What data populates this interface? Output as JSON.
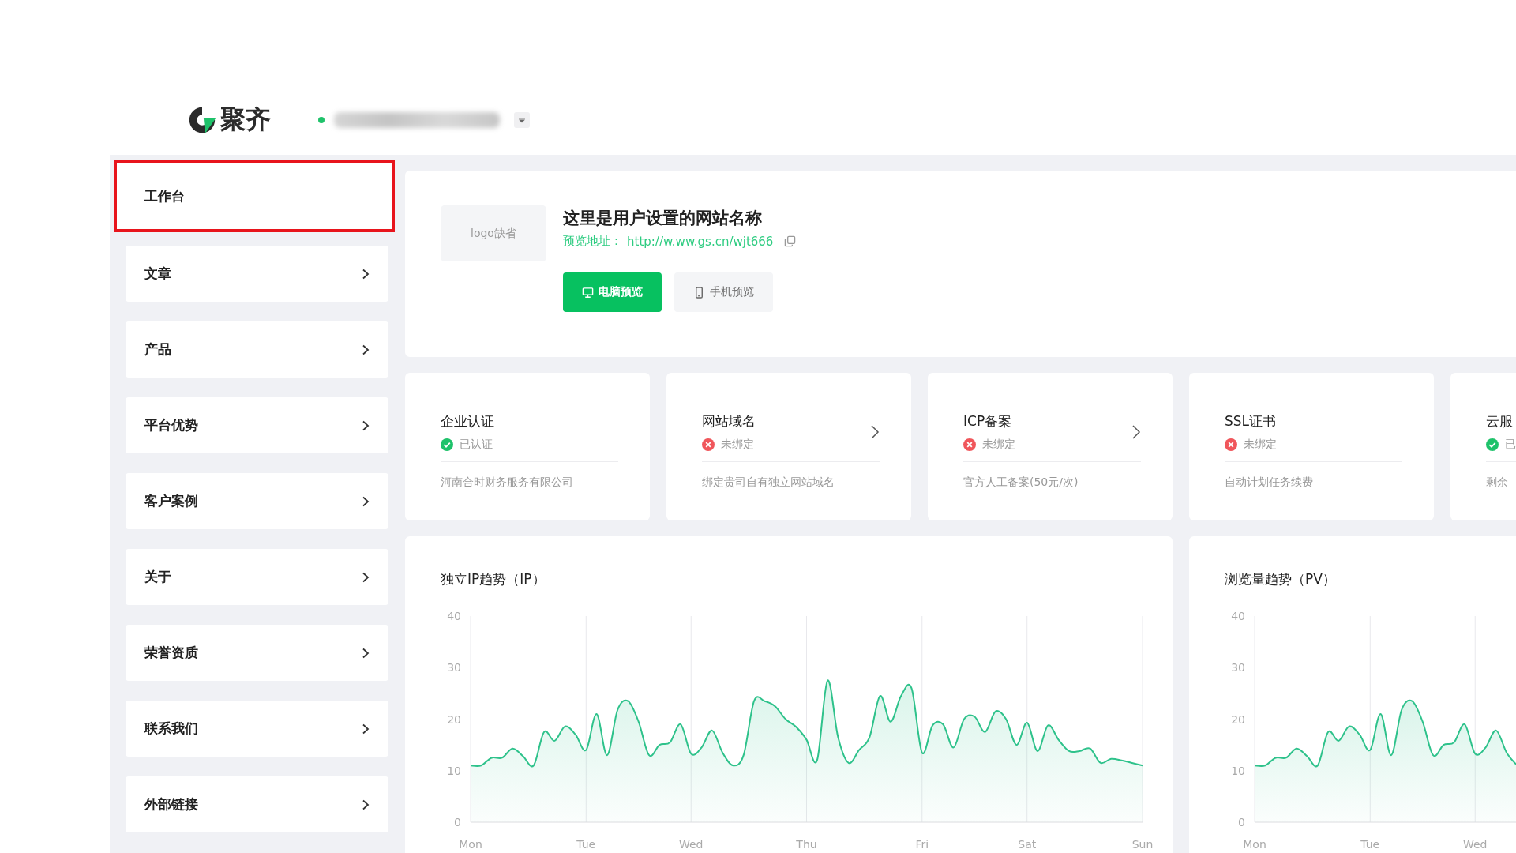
{
  "header": {
    "brand": "聚齐"
  },
  "sidebar": {
    "items": [
      {
        "label": "工作台",
        "selected": true
      },
      {
        "label": "文章",
        "selected": false
      },
      {
        "label": "产品",
        "selected": false
      },
      {
        "label": "平台优势",
        "selected": false
      },
      {
        "label": "客户案例",
        "selected": false
      },
      {
        "label": "关于",
        "selected": false
      },
      {
        "label": "荣誉资质",
        "selected": false
      },
      {
        "label": "联系我们",
        "selected": false
      },
      {
        "label": "外部链接",
        "selected": false
      }
    ]
  },
  "site": {
    "logo_placeholder": "logo缺省",
    "name": "这里是用户设置的网站名称",
    "preview_label": "预览地址：",
    "preview_url": "http://w.ww.gs.cn/wjt666",
    "buttons": [
      {
        "label": "电脑预览",
        "kind": "desktop",
        "selected": true
      },
      {
        "label": "手机预览",
        "kind": "mobile",
        "selected": false
      }
    ]
  },
  "status_cards": [
    {
      "title": "企业认证",
      "status": "已认证",
      "kind": "ok",
      "description": "河南合时财务服务有限公司",
      "link": false
    },
    {
      "title": "网站域名",
      "status": "未绑定",
      "kind": "error",
      "description": "绑定贵司自有独立网站域名",
      "link": true
    },
    {
      "title": "ICP备案",
      "status": "未绑定",
      "kind": "error",
      "description": "官方人工备案(50元/次)",
      "link": true
    },
    {
      "title": "SSL证书",
      "status": "未绑定",
      "kind": "error",
      "description": "自动计划任务续费",
      "link": false
    },
    {
      "title": "云服",
      "status": "已",
      "kind": "ok",
      "description": "剩余"
    }
  ],
  "charts": [
    {
      "title": "独立IP趋势（IP）",
      "chart_data": {
        "type": "area",
        "grid": true,
        "ylim": [
          0,
          40
        ],
        "yticks": [
          0,
          10,
          20,
          30,
          40
        ],
        "categories": [
          "Mon",
          null,
          null,
          null,
          null,
          null,
          null,
          null,
          null,
          null,
          null,
          "Tue",
          null,
          null,
          null,
          null,
          null,
          null,
          null,
          null,
          null,
          "Wed",
          null,
          null,
          null,
          null,
          null,
          null,
          null,
          null,
          null,
          null,
          "Thu",
          null,
          null,
          null,
          null,
          null,
          null,
          null,
          null,
          null,
          null,
          "Fri",
          null,
          null,
          null,
          null,
          null,
          null,
          null,
          null,
          null,
          "Sat",
          null,
          null,
          null,
          null,
          null,
          null,
          null,
          null,
          null,
          null,
          "Sun"
        ],
        "series": [
          {
            "color": "#2ec28b",
            "values": [
              11,
              11,
              12.5,
              12.5,
              14.3,
              12.8,
              11,
              17.5,
              15.8,
              18.6,
              17,
              14,
              21,
              13,
              21.8,
              23.5,
              19.5,
              13,
              15,
              15.5,
              19,
              13.3,
              14.5,
              17.8,
              13.5,
              11,
              13,
              23.5,
              23.5,
              22.5,
              20,
              18.5,
              16,
              12,
              27.5,
              16.5,
              11.5,
              14,
              16.5,
              24.5,
              19.5,
              24.5,
              26,
              13.5,
              18.8,
              19,
              14.5,
              20,
              20.5,
              17.5,
              21.5,
              20,
              15,
              19.3,
              13.8,
              18.8,
              16,
              13.8,
              13.8,
              14.3,
              11.5,
              12.3,
              12,
              11.5,
              11
            ]
          }
        ]
      }
    },
    {
      "title": "浏览量趋势（PV）",
      "chart_data": {
        "type": "area",
        "grid": true,
        "ylim": [
          0,
          40
        ],
        "yticks": [
          0,
          10,
          20,
          30,
          40
        ],
        "categories": [
          "Mon",
          null,
          null,
          null,
          null,
          null,
          null,
          null,
          null,
          null,
          null,
          "Tue",
          null,
          null,
          null,
          null,
          null,
          null,
          null,
          null,
          null,
          "Wed",
          null,
          null,
          null,
          null
        ],
        "series": [
          {
            "color": "#2ec28b",
            "values": [
              11,
              11,
              12.5,
              12.5,
              14.3,
              12.8,
              11,
              17.5,
              15.8,
              18.6,
              17,
              14,
              21,
              13,
              21.8,
              23.5,
              19.5,
              13,
              15,
              15.5,
              19,
              13.3,
              14.5,
              17.8,
              13.5,
              11
            ]
          }
        ]
      }
    }
  ]
}
